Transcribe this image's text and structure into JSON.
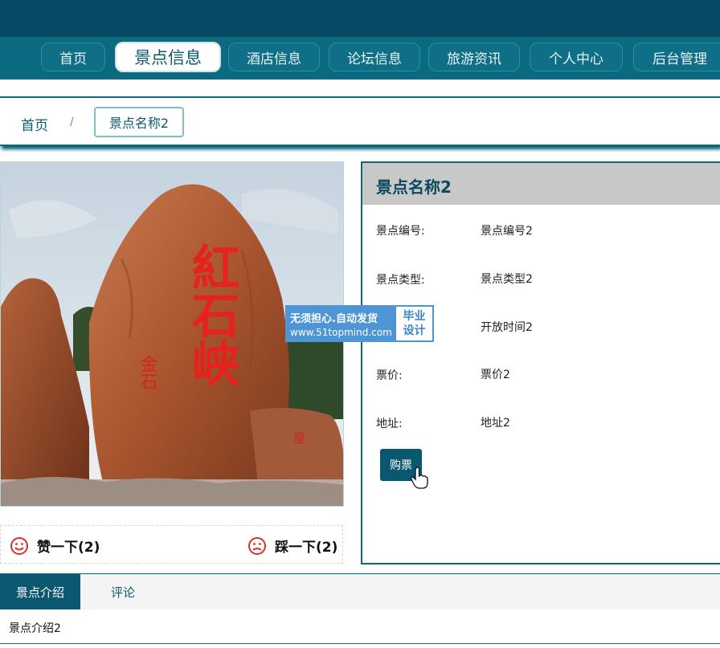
{
  "nav": {
    "items": [
      "首页",
      "景点信息",
      "酒店信息",
      "论坛信息",
      "旅游资讯",
      "个人中心",
      "后台管理"
    ],
    "active": "景点信息"
  },
  "breadcrumb": {
    "home": "首页",
    "separator": "/",
    "current": "景点名称2"
  },
  "photo": {
    "carved_text": "紅石峡",
    "small_text": "金石",
    "side_text": "皇"
  },
  "votes": {
    "like": "赞一下(2)",
    "dislike": "踩一下(2)"
  },
  "detail": {
    "title": "景点名称2",
    "rows": [
      {
        "label": "景点编号:",
        "value": "景点编号2"
      },
      {
        "label": "景点类型:",
        "value": "景点类型2"
      },
      {
        "label": "",
        "value": "开放时间2"
      },
      {
        "label": "票价:",
        "value": "票价2"
      },
      {
        "label": "地址:",
        "value": "地址2"
      }
    ],
    "buy_button": "购票"
  },
  "watermark": {
    "line1": "无须担心.自动发货",
    "line2": "www.51topmind.com",
    "badge_top": "毕业",
    "badge_bottom": "设计"
  },
  "tabs": {
    "items": [
      "景点介绍",
      "评论"
    ],
    "content": "景点介绍2"
  },
  "colors": {
    "header": "#064a66",
    "nav": "#0b6a80",
    "accent": "#0b5870",
    "panel_head": "#c8c8c8",
    "emoji": "#d9322a"
  },
  "icons": {
    "like": "smile-face-icon",
    "dislike": "frown-face-icon",
    "cursor": "hand-pointer-icon"
  }
}
